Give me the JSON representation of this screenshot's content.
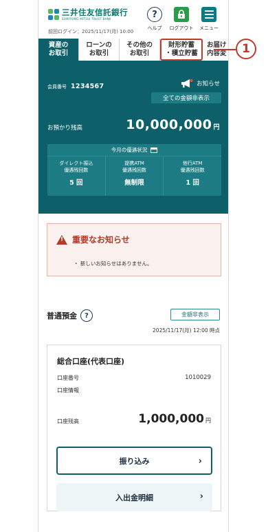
{
  "header": {
    "bank_name": "三井住友信託銀行",
    "bank_name_en": "SUMITOMO MITSUI TRUST BANK",
    "last_login": "前回ログイン：2025/11/17(月) 10:00",
    "help_label": "ヘルプ",
    "logout_label": "ログアウト",
    "menu_label": "メニュー",
    "help_glyph": "?"
  },
  "tabs": [
    {
      "label": "資産の\nお取引",
      "active": true
    },
    {
      "label": "ローンの\nお取引",
      "active": false
    },
    {
      "label": "その他の\nお取引",
      "active": false
    },
    {
      "label": "財形貯蓄\n・積立貯蓄",
      "active": false,
      "highlighted": true
    },
    {
      "label": "お届け\n内容変",
      "active": false
    }
  ],
  "account": {
    "member_label": "会員番号",
    "member_number": "1234567",
    "notice_label": "お知らせ",
    "hide_all_label": "全ての金額非表示",
    "balance_label": "お預かり残高",
    "balance_value": "10,000,000",
    "balance_unit": "円",
    "status_title": "今月の優遇状況",
    "status": [
      {
        "title": "ダイレクト振込\n優遇残回数",
        "value": "5 回"
      },
      {
        "title": "提携ATM\n優遇残回数",
        "value": "無制限"
      },
      {
        "title": "他行ATM\n優遇残回数",
        "value": "1 回"
      }
    ]
  },
  "alert": {
    "title": "重要なお知らせ",
    "text": "・ 新しいお知らせはありません。"
  },
  "savings": {
    "title": "普通預金",
    "help_glyph": "?",
    "hide_label": "金額非表示",
    "as_of": "2025/11/17(月) 12:00 時点",
    "card": {
      "title": "総合口座(代表口座)",
      "account_number_label": "口座番号",
      "account_number": "1010029",
      "account_info_label": "口座情報",
      "balance_label": "口座残高",
      "balance_value": "1,000,000",
      "balance_unit": "円",
      "transfer_label": "振り込み",
      "statement_label": "入出金明細",
      "chevron": "›"
    }
  },
  "annotation": {
    "number": "1"
  },
  "colors": {
    "brand_teal": "#0d5f6a",
    "panel_inner": "#1d7b83",
    "alert_red": "#b23b2a",
    "logout_green": "#2c9a4b"
  }
}
